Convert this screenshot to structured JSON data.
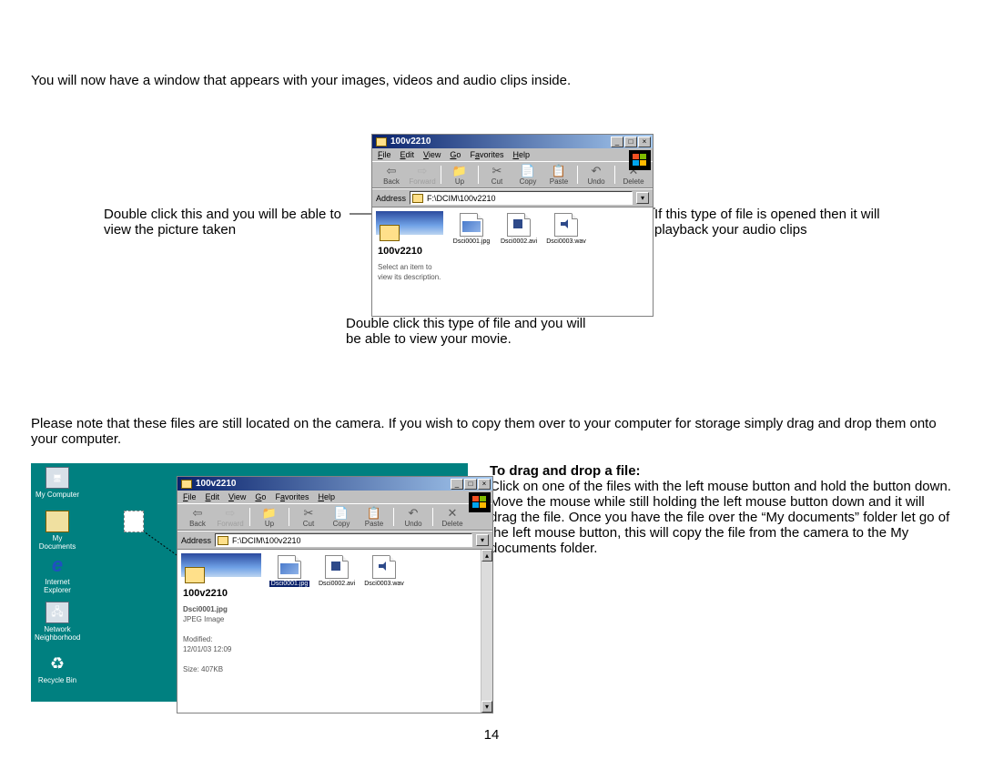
{
  "intro": "You will now have a window that appears with your images, videos and audio clips inside.",
  "callout_left": "Double click this and you will be able to view the picture taken",
  "callout_right": "If this type of file is opened then it will playback your audio clips",
  "callout_bottom": "Double click this type of file and you will be able to view your movie.",
  "note": "Please note that these files are still located on the camera. If you wish to copy them over to your computer for storage simply drag and drop them onto your computer.",
  "drag_heading": "To drag and drop a file:",
  "drag_body": "Click on one of the files with the left mouse button and hold the button down. Move the mouse while still holding the left mouse button down and it will drag the file. Once you have the file over the “My documents” folder let go of the left mouse button, this will copy the file from the camera to the My documents folder.",
  "page_number": "14",
  "explorer": {
    "title": "100v2210",
    "menu": [
      "File",
      "Edit",
      "View",
      "Go",
      "Favorites",
      "Help"
    ],
    "toolbar": [
      "Back",
      "Forward",
      "Up",
      "Cut",
      "Copy",
      "Paste",
      "Undo",
      "Delete"
    ],
    "address_label": "Address",
    "address_value": "F:\\DCIM\\100v2210",
    "panel_title": "100v2210",
    "panel_hint": "Select an item to view its description.",
    "files": [
      "Dsci0001.jpg",
      "Dsci0002.avi",
      "Dsci0003.wav"
    ],
    "selected_file": "Dsci0001.jpg",
    "detail_type": "JPEG Image",
    "detail_modified_label": "Modified:",
    "detail_modified": "12/01/03 12:09",
    "detail_size": "Size: 407KB"
  },
  "desktop_icons": [
    {
      "label": "My Computer",
      "color": "#d8e0e8"
    },
    {
      "label": "My Documents",
      "color": "#f0e0a0"
    },
    {
      "label": "Internet Explorer",
      "color": "#2050c0"
    },
    {
      "label": "Network Neighborhood",
      "color": "#d8e0e8"
    },
    {
      "label": "Recycle Bin",
      "color": "#d8e0e8"
    }
  ]
}
